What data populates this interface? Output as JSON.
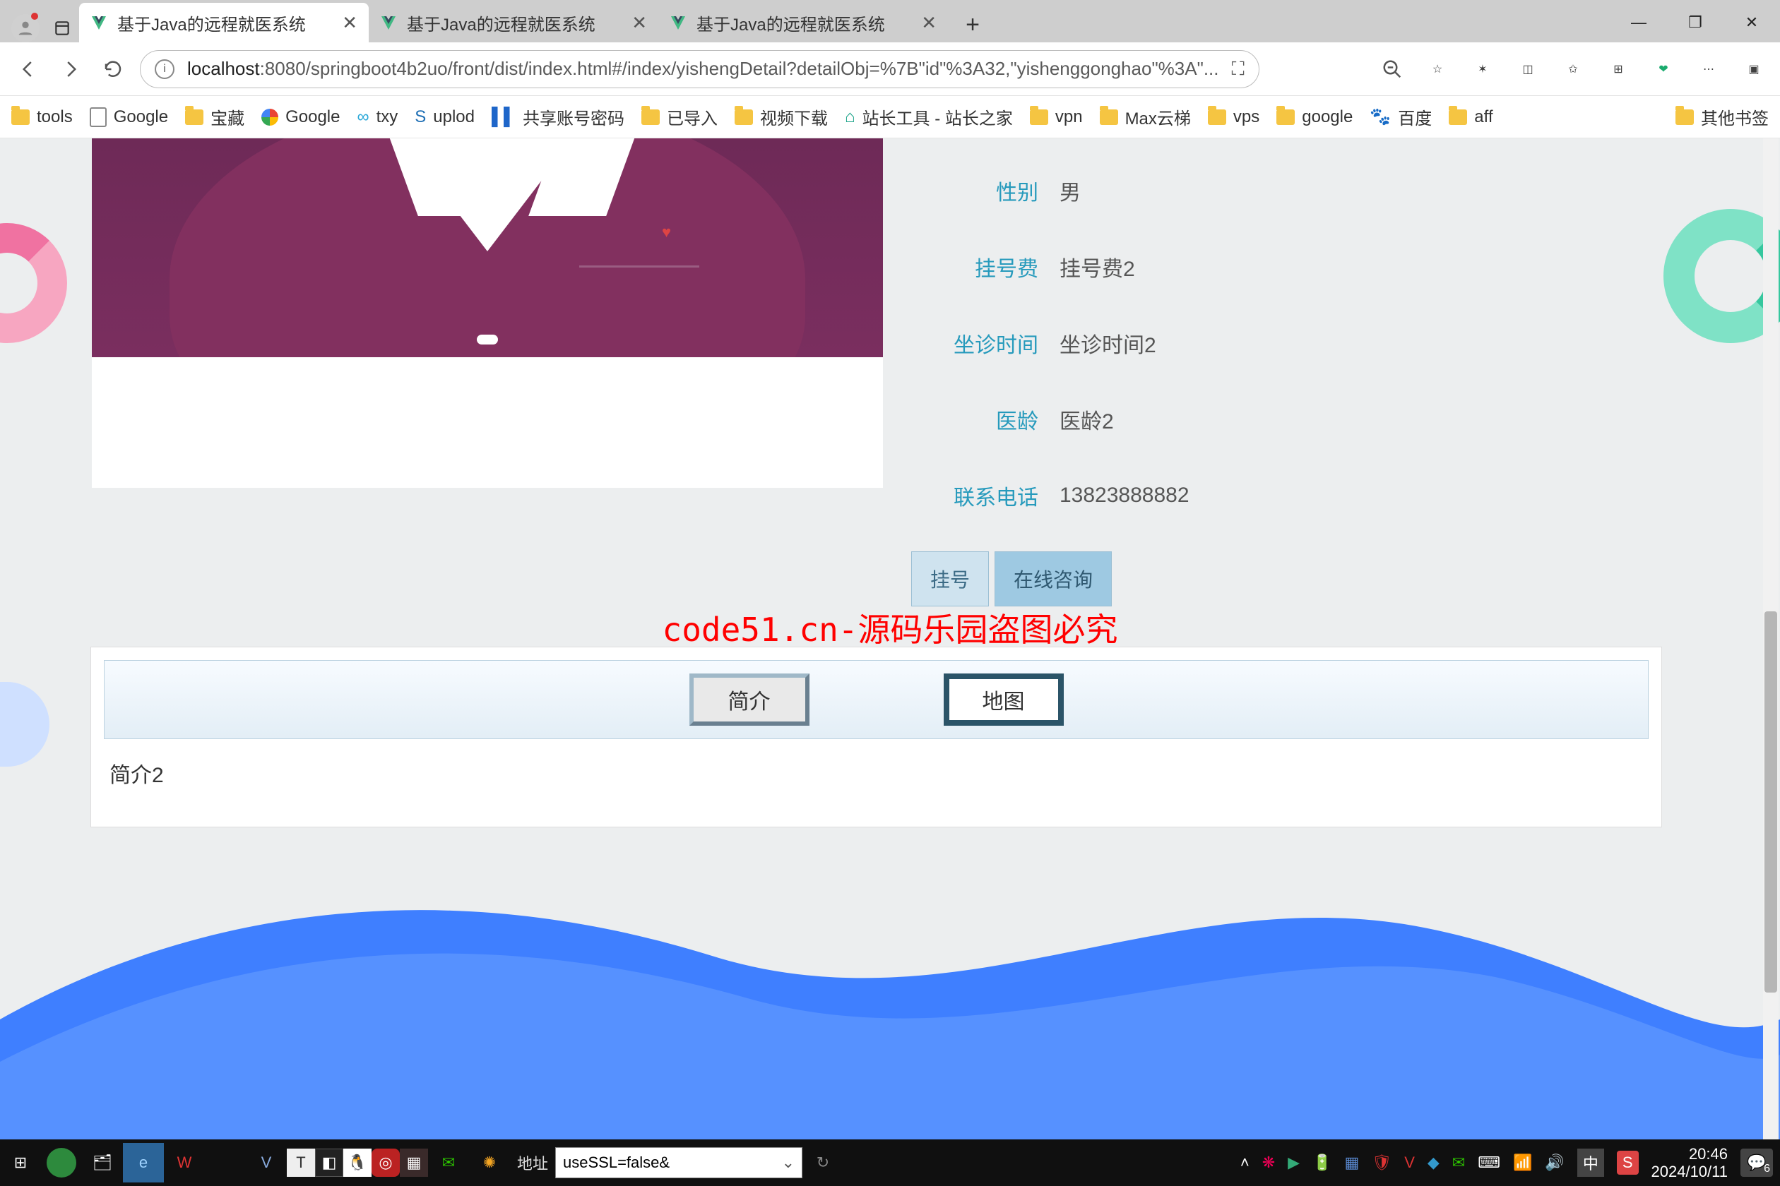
{
  "tabs": [
    {
      "title": "基于Java的远程就医系统",
      "active": true
    },
    {
      "title": "基于Java的远程就医系统",
      "active": false
    },
    {
      "title": "基于Java的远程就医系统",
      "active": false
    }
  ],
  "url": {
    "host": "localhost",
    "rest": ":8080/springboot4b2uo/front/dist/index.html#/index/yishengDetail?detailObj=%7B\"id\"%3A32,\"yishenggonghao\"%3A\"..."
  },
  "bookmarks": [
    {
      "label": "tools",
      "icon": "folder"
    },
    {
      "label": "Google",
      "icon": "page"
    },
    {
      "label": "宝藏",
      "icon": "folder"
    },
    {
      "label": "Google",
      "icon": "g"
    },
    {
      "label": "txy",
      "icon": "cloud"
    },
    {
      "label": "uplod",
      "icon": "s"
    },
    {
      "label": "共享账号密码",
      "icon": "flag"
    },
    {
      "label": "已导入",
      "icon": "folder"
    },
    {
      "label": "视频下载",
      "icon": "folder"
    },
    {
      "label": "站长工具 - 站长之家",
      "icon": "zz"
    },
    {
      "label": "vpn",
      "icon": "folder"
    },
    {
      "label": "Max云梯",
      "icon": "folder"
    },
    {
      "label": "vps",
      "icon": "folder"
    },
    {
      "label": "google",
      "icon": "folder"
    },
    {
      "label": "百度",
      "icon": "baidu"
    },
    {
      "label": "aff",
      "icon": "folder"
    }
  ],
  "bookmarks_overflow": "其他书签",
  "doctor": {
    "fields": [
      {
        "label": "性别",
        "value": "男"
      },
      {
        "label": "挂号费",
        "value": "挂号费2"
      },
      {
        "label": "坐诊时间",
        "value": "坐诊时间2"
      },
      {
        "label": "医龄",
        "value": "医龄2"
      },
      {
        "label": "联系电话",
        "value": "13823888882"
      }
    ],
    "actions": {
      "register": "挂号",
      "consult": "在线咨询"
    }
  },
  "watermark": "code51.cn-源码乐园盗图必究",
  "detail_tabs": {
    "intro": "简介",
    "map": "地图"
  },
  "detail_body": "简介2",
  "taskbar": {
    "addr_label": "地址",
    "addr_value": "useSSL=false&",
    "ime": "中",
    "time": "20:46",
    "date": "2024/10/11",
    "notif_count": "6"
  }
}
